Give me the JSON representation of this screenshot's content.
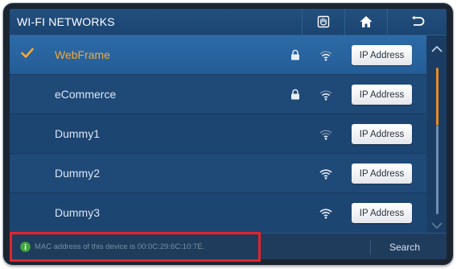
{
  "header": {
    "title": "WI-FI NETWORKS",
    "buttons": [
      {
        "icon": "wps-icon"
      },
      {
        "icon": "home-icon"
      },
      {
        "icon": "back-icon"
      }
    ]
  },
  "networks": [
    {
      "name": "WebFrame",
      "connected": true,
      "secured": true,
      "signal": "medium",
      "button": "IP Address"
    },
    {
      "name": "eCommerce",
      "connected": false,
      "secured": true,
      "signal": "medium",
      "button": "IP Address"
    },
    {
      "name": "Dummy1",
      "connected": false,
      "secured": false,
      "signal": "low",
      "button": "IP Address"
    },
    {
      "name": "Dummy2",
      "connected": false,
      "secured": false,
      "signal": "full",
      "button": "IP Address"
    },
    {
      "name": "Dummy3",
      "connected": false,
      "secured": false,
      "signal": "full",
      "button": "IP Address"
    }
  ],
  "footer": {
    "message": "MAC address of this device is 00:0C:29:6C:10:7E.",
    "search_label": "Search"
  },
  "colors": {
    "accent": "#f2a93b",
    "scroll_thumb": "#e88a22",
    "highlight": "#e5242b",
    "info": "#3fa83a"
  }
}
